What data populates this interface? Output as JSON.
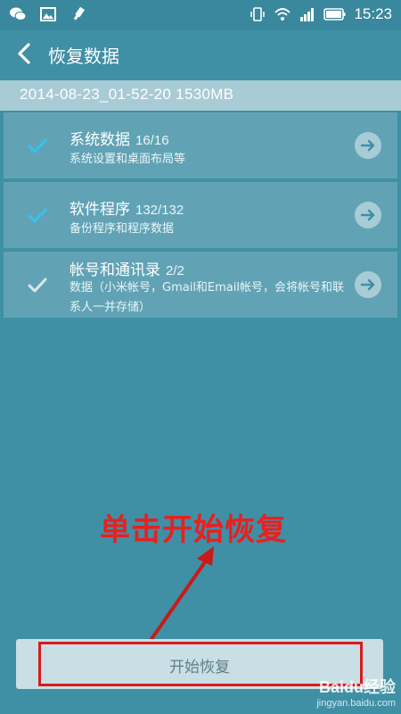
{
  "status_bar": {
    "time": "15:23",
    "left_icons": [
      "wechat-icon",
      "image-icon",
      "usb-icon"
    ],
    "right_icons": [
      "vibrate-icon",
      "wifi-icon",
      "signal-icon",
      "battery-icon"
    ]
  },
  "header": {
    "title": "恢复数据",
    "back_icon": "chevron-left-icon"
  },
  "backup": {
    "info": "2014-08-23_01-52-20   1530MB"
  },
  "items": [
    {
      "title": "系统数据",
      "count": "16/16",
      "desc": "系统设置和桌面布局等",
      "checked": true
    },
    {
      "title": "软件程序",
      "count": "132/132",
      "desc": "备份程序和程序数据",
      "checked": true
    },
    {
      "title": "帐号和通讯录",
      "count": "2/2",
      "desc": "数据（小米帐号，Gmail和Email帐号，会将帐号和联系人一并存储）",
      "checked": true
    }
  ],
  "annotation": {
    "text": "单击开始恢复"
  },
  "start_button": {
    "label": "开始恢复"
  },
  "watermark": {
    "logo": "Baidu经验",
    "url": "jingyan.baidu.com"
  },
  "colors": {
    "background": "#3f8fa5",
    "accent_check": "#35c3f0",
    "annotation_red": "#e82020"
  }
}
